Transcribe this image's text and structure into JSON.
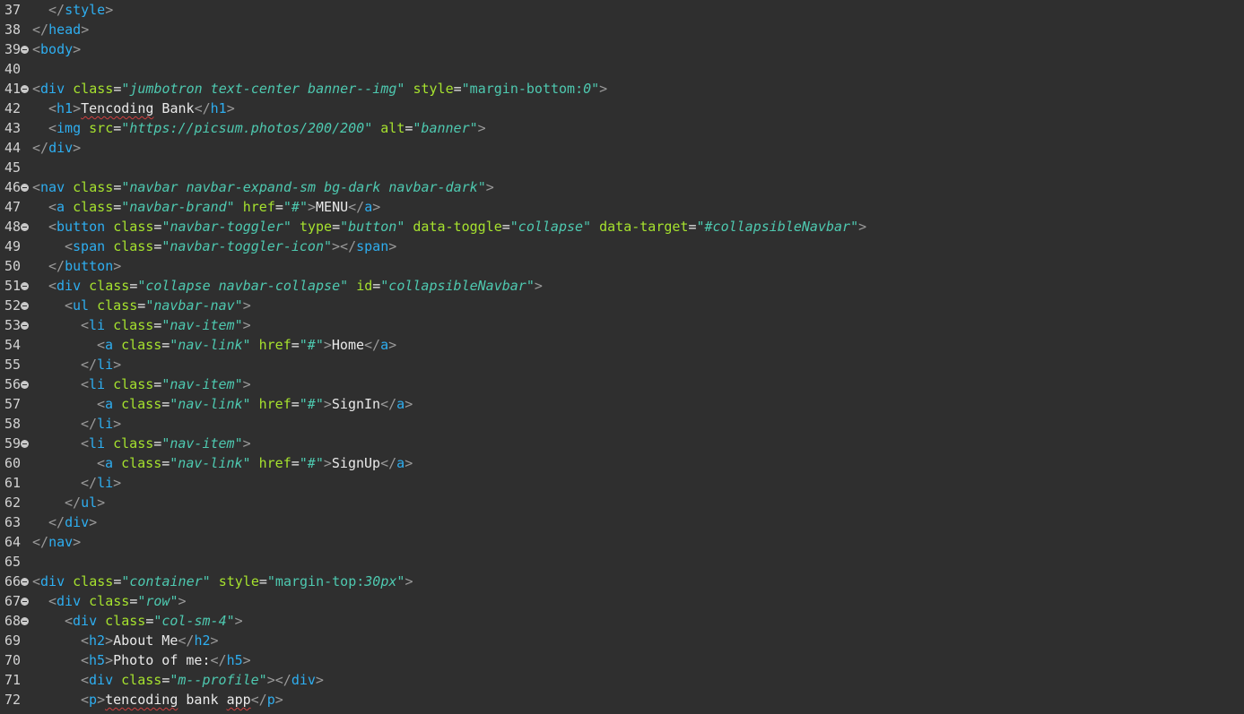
{
  "editor": {
    "lines": [
      {
        "n": "37",
        "fold": false,
        "indent": 1,
        "tokens": [
          [
            "p",
            "</"
          ],
          [
            "t",
            "style"
          ],
          [
            "p",
            ">"
          ]
        ]
      },
      {
        "n": "38",
        "fold": false,
        "indent": 0,
        "tokens": [
          [
            "p",
            "</"
          ],
          [
            "t",
            "head"
          ],
          [
            "p",
            ">"
          ]
        ]
      },
      {
        "n": "39",
        "fold": true,
        "indent": 0,
        "tokens": [
          [
            "p",
            "<"
          ],
          [
            "t",
            "body"
          ],
          [
            "p",
            ">"
          ]
        ]
      },
      {
        "n": "40",
        "fold": false,
        "indent": 0,
        "tokens": []
      },
      {
        "n": "41",
        "fold": true,
        "indent": 0,
        "tokens": [
          [
            "p",
            "<"
          ],
          [
            "t",
            "div"
          ],
          [
            "x",
            " "
          ],
          [
            "a",
            "class"
          ],
          [
            "x",
            "="
          ],
          [
            "v",
            "\"jumbotron text-center banner--img\""
          ],
          [
            "x",
            " "
          ],
          [
            "a",
            "style"
          ],
          [
            "x",
            "="
          ],
          [
            "s",
            "\"margin-bottom:"
          ],
          [
            "v",
            "0"
          ],
          [
            "s",
            "\""
          ],
          [
            "p",
            ">"
          ]
        ]
      },
      {
        "n": "42",
        "fold": false,
        "indent": 1,
        "tokens": [
          [
            "p",
            "<"
          ],
          [
            "t",
            "h1"
          ],
          [
            "p",
            ">"
          ],
          [
            "x",
            "Tencoding",
            1
          ],
          [
            "x",
            " Bank"
          ],
          [
            "p",
            "</"
          ],
          [
            "t",
            "h1"
          ],
          [
            "p",
            ">"
          ]
        ]
      },
      {
        "n": "43",
        "fold": false,
        "indent": 1,
        "tokens": [
          [
            "p",
            "<"
          ],
          [
            "t",
            "img"
          ],
          [
            "x",
            " "
          ],
          [
            "a",
            "src"
          ],
          [
            "x",
            "="
          ],
          [
            "v",
            "\"https://picsum.photos/200/200\""
          ],
          [
            "x",
            " "
          ],
          [
            "a",
            "alt"
          ],
          [
            "x",
            "="
          ],
          [
            "v",
            "\"banner\""
          ],
          [
            "p",
            ">"
          ]
        ]
      },
      {
        "n": "44",
        "fold": false,
        "indent": 0,
        "tokens": [
          [
            "p",
            "</"
          ],
          [
            "t",
            "div"
          ],
          [
            "p",
            ">"
          ]
        ]
      },
      {
        "n": "45",
        "fold": false,
        "indent": 0,
        "tokens": []
      },
      {
        "n": "46",
        "fold": true,
        "indent": 0,
        "tokens": [
          [
            "p",
            "<"
          ],
          [
            "t",
            "nav"
          ],
          [
            "x",
            " "
          ],
          [
            "a",
            "class"
          ],
          [
            "x",
            "="
          ],
          [
            "v",
            "\"navbar navbar-expand-sm bg-dark navbar-dark\""
          ],
          [
            "p",
            ">"
          ]
        ]
      },
      {
        "n": "47",
        "fold": false,
        "indent": 1,
        "tokens": [
          [
            "p",
            "<"
          ],
          [
            "t",
            "a"
          ],
          [
            "x",
            " "
          ],
          [
            "a",
            "class"
          ],
          [
            "x",
            "="
          ],
          [
            "v",
            "\"navbar-brand\""
          ],
          [
            "x",
            " "
          ],
          [
            "a",
            "href"
          ],
          [
            "x",
            "="
          ],
          [
            "v",
            "\"#\""
          ],
          [
            "p",
            ">"
          ],
          [
            "x",
            "MENU"
          ],
          [
            "p",
            "</"
          ],
          [
            "t",
            "a"
          ],
          [
            "p",
            ">"
          ]
        ]
      },
      {
        "n": "48",
        "fold": true,
        "indent": 1,
        "tokens": [
          [
            "p",
            "<"
          ],
          [
            "t",
            "button"
          ],
          [
            "x",
            " "
          ],
          [
            "a",
            "class"
          ],
          [
            "x",
            "="
          ],
          [
            "v",
            "\"navbar-toggler\""
          ],
          [
            "x",
            " "
          ],
          [
            "a",
            "type"
          ],
          [
            "x",
            "="
          ],
          [
            "v",
            "\"button\""
          ],
          [
            "x",
            " "
          ],
          [
            "a",
            "data-toggle"
          ],
          [
            "x",
            "="
          ],
          [
            "v",
            "\"collapse\""
          ],
          [
            "x",
            " "
          ],
          [
            "a",
            "data-target"
          ],
          [
            "x",
            "="
          ],
          [
            "v",
            "\"#collapsibleNavbar\""
          ],
          [
            "p",
            ">"
          ]
        ]
      },
      {
        "n": "49",
        "fold": false,
        "indent": 2,
        "tokens": [
          [
            "p",
            "<"
          ],
          [
            "t",
            "span"
          ],
          [
            "x",
            " "
          ],
          [
            "a",
            "class"
          ],
          [
            "x",
            "="
          ],
          [
            "v",
            "\"navbar-toggler-icon\""
          ],
          [
            "p",
            "></"
          ],
          [
            "t",
            "span"
          ],
          [
            "p",
            ">"
          ]
        ]
      },
      {
        "n": "50",
        "fold": false,
        "indent": 1,
        "tokens": [
          [
            "p",
            "</"
          ],
          [
            "t",
            "button"
          ],
          [
            "p",
            ">"
          ]
        ]
      },
      {
        "n": "51",
        "fold": true,
        "indent": 1,
        "tokens": [
          [
            "p",
            "<"
          ],
          [
            "t",
            "div"
          ],
          [
            "x",
            " "
          ],
          [
            "a",
            "class"
          ],
          [
            "x",
            "="
          ],
          [
            "v",
            "\"collapse navbar-collapse\""
          ],
          [
            "x",
            " "
          ],
          [
            "a",
            "id"
          ],
          [
            "x",
            "="
          ],
          [
            "v",
            "\"collapsibleNavbar\""
          ],
          [
            "p",
            ">"
          ]
        ]
      },
      {
        "n": "52",
        "fold": true,
        "indent": 2,
        "tokens": [
          [
            "p",
            "<"
          ],
          [
            "t",
            "ul"
          ],
          [
            "x",
            " "
          ],
          [
            "a",
            "class"
          ],
          [
            "x",
            "="
          ],
          [
            "v",
            "\"navbar-nav\""
          ],
          [
            "p",
            ">"
          ]
        ]
      },
      {
        "n": "53",
        "fold": true,
        "indent": 3,
        "tokens": [
          [
            "p",
            "<"
          ],
          [
            "t",
            "li"
          ],
          [
            "x",
            " "
          ],
          [
            "a",
            "class"
          ],
          [
            "x",
            "="
          ],
          [
            "v",
            "\"nav-item\""
          ],
          [
            "p",
            ">"
          ]
        ]
      },
      {
        "n": "54",
        "fold": false,
        "indent": 4,
        "tokens": [
          [
            "p",
            "<"
          ],
          [
            "t",
            "a"
          ],
          [
            "x",
            " "
          ],
          [
            "a",
            "class"
          ],
          [
            "x",
            "="
          ],
          [
            "v",
            "\"nav-link\""
          ],
          [
            "x",
            " "
          ],
          [
            "a",
            "href"
          ],
          [
            "x",
            "="
          ],
          [
            "v",
            "\"#\""
          ],
          [
            "p",
            ">"
          ],
          [
            "x",
            "Home"
          ],
          [
            "p",
            "</"
          ],
          [
            "t",
            "a"
          ],
          [
            "p",
            ">"
          ]
        ]
      },
      {
        "n": "55",
        "fold": false,
        "indent": 3,
        "tokens": [
          [
            "p",
            "</"
          ],
          [
            "t",
            "li"
          ],
          [
            "p",
            ">"
          ]
        ]
      },
      {
        "n": "56",
        "fold": true,
        "indent": 3,
        "tokens": [
          [
            "p",
            "<"
          ],
          [
            "t",
            "li"
          ],
          [
            "x",
            " "
          ],
          [
            "a",
            "class"
          ],
          [
            "x",
            "="
          ],
          [
            "v",
            "\"nav-item\""
          ],
          [
            "p",
            ">"
          ]
        ]
      },
      {
        "n": "57",
        "fold": false,
        "indent": 4,
        "tokens": [
          [
            "p",
            "<"
          ],
          [
            "t",
            "a"
          ],
          [
            "x",
            " "
          ],
          [
            "a",
            "class"
          ],
          [
            "x",
            "="
          ],
          [
            "v",
            "\"nav-link\""
          ],
          [
            "x",
            " "
          ],
          [
            "a",
            "href"
          ],
          [
            "x",
            "="
          ],
          [
            "v",
            "\"#\""
          ],
          [
            "p",
            ">"
          ],
          [
            "x",
            "SignIn"
          ],
          [
            "p",
            "</"
          ],
          [
            "t",
            "a"
          ],
          [
            "p",
            ">"
          ]
        ]
      },
      {
        "n": "58",
        "fold": false,
        "indent": 3,
        "tokens": [
          [
            "p",
            "</"
          ],
          [
            "t",
            "li"
          ],
          [
            "p",
            ">"
          ]
        ]
      },
      {
        "n": "59",
        "fold": true,
        "indent": 3,
        "tokens": [
          [
            "p",
            "<"
          ],
          [
            "t",
            "li"
          ],
          [
            "x",
            " "
          ],
          [
            "a",
            "class"
          ],
          [
            "x",
            "="
          ],
          [
            "v",
            "\"nav-item\""
          ],
          [
            "p",
            ">"
          ]
        ]
      },
      {
        "n": "60",
        "fold": false,
        "indent": 4,
        "tokens": [
          [
            "p",
            "<"
          ],
          [
            "t",
            "a"
          ],
          [
            "x",
            " "
          ],
          [
            "a",
            "class"
          ],
          [
            "x",
            "="
          ],
          [
            "v",
            "\"nav-link\""
          ],
          [
            "x",
            " "
          ],
          [
            "a",
            "href"
          ],
          [
            "x",
            "="
          ],
          [
            "v",
            "\"#\""
          ],
          [
            "p",
            ">"
          ],
          [
            "x",
            "SignUp"
          ],
          [
            "p",
            "</"
          ],
          [
            "t",
            "a"
          ],
          [
            "p",
            ">"
          ]
        ]
      },
      {
        "n": "61",
        "fold": false,
        "indent": 3,
        "tokens": [
          [
            "p",
            "</"
          ],
          [
            "t",
            "li"
          ],
          [
            "p",
            ">"
          ]
        ]
      },
      {
        "n": "62",
        "fold": false,
        "indent": 2,
        "tokens": [
          [
            "p",
            "</"
          ],
          [
            "t",
            "ul"
          ],
          [
            "p",
            ">"
          ]
        ]
      },
      {
        "n": "63",
        "fold": false,
        "indent": 1,
        "tokens": [
          [
            "p",
            "</"
          ],
          [
            "t",
            "div"
          ],
          [
            "p",
            ">"
          ]
        ]
      },
      {
        "n": "64",
        "fold": false,
        "indent": 0,
        "tokens": [
          [
            "p",
            "</"
          ],
          [
            "t",
            "nav"
          ],
          [
            "p",
            ">"
          ]
        ]
      },
      {
        "n": "65",
        "fold": false,
        "indent": 0,
        "tokens": []
      },
      {
        "n": "66",
        "fold": true,
        "indent": 0,
        "tokens": [
          [
            "p",
            "<"
          ],
          [
            "t",
            "div"
          ],
          [
            "x",
            " "
          ],
          [
            "a",
            "class"
          ],
          [
            "x",
            "="
          ],
          [
            "v",
            "\"container\""
          ],
          [
            "x",
            " "
          ],
          [
            "a",
            "style"
          ],
          [
            "x",
            "="
          ],
          [
            "s",
            "\"margin-top:"
          ],
          [
            "v",
            "30px"
          ],
          [
            "s",
            "\""
          ],
          [
            "p",
            ">"
          ]
        ]
      },
      {
        "n": "67",
        "fold": true,
        "indent": 1,
        "tokens": [
          [
            "p",
            "<"
          ],
          [
            "t",
            "div"
          ],
          [
            "x",
            " "
          ],
          [
            "a",
            "class"
          ],
          [
            "x",
            "="
          ],
          [
            "v",
            "\"row\""
          ],
          [
            "p",
            ">"
          ]
        ]
      },
      {
        "n": "68",
        "fold": true,
        "indent": 2,
        "tokens": [
          [
            "p",
            "<"
          ],
          [
            "t",
            "div"
          ],
          [
            "x",
            " "
          ],
          [
            "a",
            "class"
          ],
          [
            "x",
            "="
          ],
          [
            "v",
            "\"col-sm-4\""
          ],
          [
            "p",
            ">"
          ]
        ]
      },
      {
        "n": "69",
        "fold": false,
        "indent": 3,
        "tokens": [
          [
            "p",
            "<"
          ],
          [
            "t",
            "h2"
          ],
          [
            "p",
            ">"
          ],
          [
            "x",
            "About Me"
          ],
          [
            "p",
            "</"
          ],
          [
            "t",
            "h2"
          ],
          [
            "p",
            ">"
          ]
        ]
      },
      {
        "n": "70",
        "fold": false,
        "indent": 3,
        "tokens": [
          [
            "p",
            "<"
          ],
          [
            "t",
            "h5"
          ],
          [
            "p",
            ">"
          ],
          [
            "x",
            "Photo of me:"
          ],
          [
            "p",
            "</"
          ],
          [
            "t",
            "h5"
          ],
          [
            "p",
            ">"
          ]
        ]
      },
      {
        "n": "71",
        "fold": false,
        "indent": 3,
        "tokens": [
          [
            "p",
            "<"
          ],
          [
            "t",
            "div"
          ],
          [
            "x",
            " "
          ],
          [
            "a",
            "class"
          ],
          [
            "x",
            "="
          ],
          [
            "v",
            "\"m--profile\""
          ],
          [
            "p",
            "></"
          ],
          [
            "t",
            "div"
          ],
          [
            "p",
            ">"
          ]
        ]
      },
      {
        "n": "72",
        "fold": false,
        "indent": 3,
        "tokens": [
          [
            "p",
            "<"
          ],
          [
            "t",
            "p"
          ],
          [
            "p",
            ">"
          ],
          [
            "x",
            "tencoding",
            1
          ],
          [
            "x",
            " bank "
          ],
          [
            "x",
            "app",
            1
          ],
          [
            "p",
            "</"
          ],
          [
            "t",
            "p"
          ],
          [
            "p",
            ">"
          ]
        ]
      }
    ]
  }
}
